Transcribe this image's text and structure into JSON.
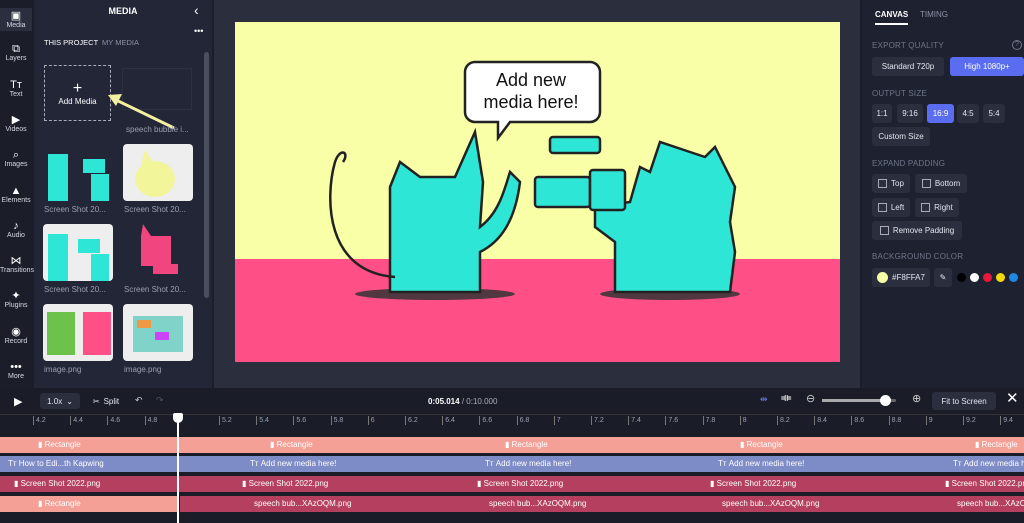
{
  "rail": [
    {
      "label": "Media",
      "icon": "media-icon",
      "glyph": "▣"
    },
    {
      "label": "Layers",
      "icon": "layers-icon",
      "glyph": "⧉"
    },
    {
      "label": "Text",
      "icon": "text-icon",
      "glyph": "Tт"
    },
    {
      "label": "Videos",
      "icon": "videos-icon",
      "glyph": "▶"
    },
    {
      "label": "Images",
      "icon": "images-icon",
      "glyph": "⌕"
    },
    {
      "label": "Elements",
      "icon": "elements-icon",
      "glyph": "▲"
    },
    {
      "label": "Audio",
      "icon": "audio-icon",
      "glyph": "♪"
    },
    {
      "label": "Transitions",
      "icon": "transitions-icon",
      "glyph": "⋈"
    },
    {
      "label": "Plugins",
      "icon": "plugins-icon",
      "glyph": "✦"
    },
    {
      "label": "Record",
      "icon": "record-icon",
      "glyph": "◉"
    },
    {
      "label": "More",
      "icon": "more-icon",
      "glyph": "•••"
    }
  ],
  "media": {
    "title": "MEDIA",
    "tabs": [
      "THIS PROJECT",
      "MY MEDIA"
    ],
    "add_label": "Add Media",
    "items": [
      "speech bubble i...",
      "Screen Shot 20...",
      "Screen Shot 20...",
      "Screen Shot 20...",
      "Screen Shot 20...",
      "image.png",
      "image.png"
    ]
  },
  "canvas": {
    "bg": "#F8FFA7",
    "floor": "#FF4F87",
    "cat": "#2EE6D6",
    "bubble": "Add new media here!",
    "bubble_line1": "Add new",
    "bubble_line2": "media here!"
  },
  "props": {
    "tabs": [
      "CANVAS",
      "TIMING"
    ],
    "export_quality": "EXPORT QUALITY",
    "quality_options": [
      "Standard 720p",
      "High 1080p+"
    ],
    "output_size": "OUTPUT SIZE",
    "sizes": [
      "1:1",
      "9:16",
      "16:9",
      "4:5",
      "5:4"
    ],
    "custom_size": "Custom Size",
    "expand_padding": "EXPAND PADDING",
    "padding": [
      "Top",
      "Bottom",
      "Left",
      "Right",
      "Remove Padding"
    ],
    "background_color": "BACKGROUND COLOR",
    "color_value": "#F8FFA7",
    "swatches": [
      "#000000",
      "#ffffff",
      "#e8173d",
      "#f5d90a",
      "#1e88e5"
    ]
  },
  "timeline": {
    "speed": "1.0x",
    "split": "Split",
    "time_current": "0:05.014",
    "time_total": "/ 0:10.000",
    "fit": "Fit to Screen",
    "zoom_level": 0.85,
    "ticks": [
      "4.2",
      "4.4",
      "4.6",
      "4.8",
      "5.2",
      "5.4",
      "5.6",
      "5.8",
      "6",
      "6.2",
      "6.4",
      "6.6",
      "6.8",
      "7",
      "7.2",
      "7.4",
      "7.6",
      "7.8",
      "8",
      "8.2",
      "8.4",
      "8.6",
      "8.8",
      "9",
      "9.2",
      "9.4"
    ],
    "tracks": {
      "rectangle": "Rectangle",
      "text_first": "How to Edi...th Kapwing",
      "text": "Add new media here!",
      "screenshot": "Screen Shot 2022.png",
      "speech": "speech bub...XAzOQM.png"
    }
  }
}
